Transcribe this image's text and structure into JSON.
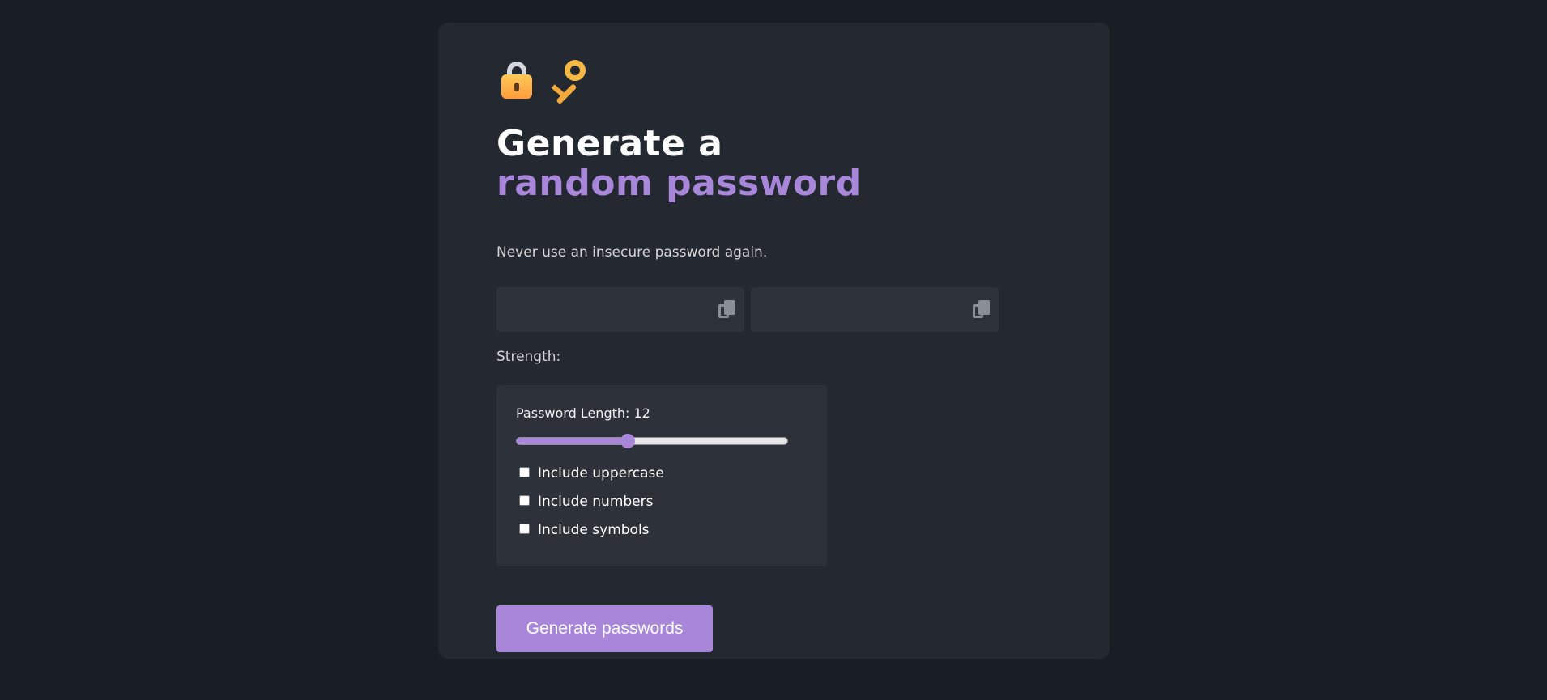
{
  "header": {
    "emoji_1": "lock-icon",
    "emoji_2": "key-icon",
    "title_line1": "Generate a",
    "title_line2": "random password",
    "subtitle": "Never use an insecure password again."
  },
  "passwords": [
    {
      "value": ""
    },
    {
      "value": ""
    }
  ],
  "strength_label": "Strength:",
  "options": {
    "length_label": "Password Length: 12",
    "length_value": 12,
    "length_fill_fraction": 0.41,
    "checkboxes": [
      {
        "label": "Include uppercase",
        "checked": false
      },
      {
        "label": "Include numbers",
        "checked": false
      },
      {
        "label": "Include symbols",
        "checked": false
      }
    ]
  },
  "generate_button": "Generate passwords",
  "colors": {
    "page_bg": "#191d24",
    "card_bg": "#242831",
    "accent": "#a887da",
    "field_bg": "#2e323a"
  }
}
